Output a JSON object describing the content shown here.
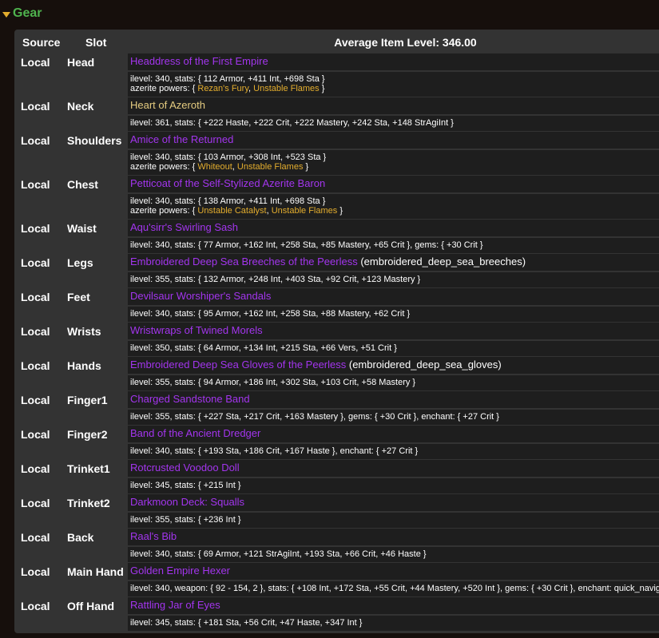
{
  "section": {
    "title": "Gear"
  },
  "table": {
    "headers": {
      "source": "Source",
      "slot": "Slot",
      "summary": "Average Item Level: 346.00"
    },
    "items": [
      {
        "source": "Local",
        "slot": "Head",
        "name": "Headdress of the First Empire",
        "extra": "",
        "detail": "ilevel: 340, stats: { 112 Armor, +411 Int, +698 Sta }",
        "azerite_prefix": "azerite powers: { ",
        "azerite": [
          "Rezan's Fury",
          "Unstable Flames"
        ],
        "azerite_sep": ", ",
        "azerite_suffix": " }"
      },
      {
        "source": "Local",
        "slot": "Neck",
        "name": "Heart of Azeroth",
        "extra": "",
        "detail": "ilevel: 361, stats: { +222 Haste, +222 Crit, +222 Mastery, +242 Sta, +148 StrAgiInt }"
      },
      {
        "source": "Local",
        "slot": "Shoulders",
        "name": "Amice of the Returned",
        "extra": "",
        "detail": "ilevel: 340, stats: { 103 Armor, +308 Int, +523 Sta }",
        "azerite_prefix": "azerite powers: { ",
        "azerite": [
          "Whiteout",
          "Unstable Flames"
        ],
        "azerite_sep": ", ",
        "azerite_suffix": " }"
      },
      {
        "source": "Local",
        "slot": "Chest",
        "name": "Petticoat of the Self-Stylized Azerite Baron",
        "extra": "",
        "detail": "ilevel: 340, stats: { 138 Armor, +411 Int, +698 Sta }",
        "azerite_prefix": "azerite powers: { ",
        "azerite": [
          "Unstable Catalyst",
          "Unstable Flames"
        ],
        "azerite_sep": ", ",
        "azerite_suffix": " }"
      },
      {
        "source": "Local",
        "slot": "Waist",
        "name": "Aqu'sirr's Swirling Sash",
        "extra": "",
        "detail": "ilevel: 340, stats: { 77 Armor, +162 Int, +258 Sta, +85 Mastery, +65 Crit }, gems: { +30 Crit }"
      },
      {
        "source": "Local",
        "slot": "Legs",
        "name": "Embroidered Deep Sea Breeches of the Peerless",
        "extra": " (embroidered_deep_sea_breeches)",
        "detail": "ilevel: 355, stats: { 132 Armor, +248 Int, +403 Sta, +92 Crit, +123 Mastery }"
      },
      {
        "source": "Local",
        "slot": "Feet",
        "name": "Devilsaur Worshiper's Sandals",
        "extra": "",
        "detail": "ilevel: 340, stats: { 95 Armor, +162 Int, +258 Sta, +88 Mastery, +62 Crit }"
      },
      {
        "source": "Local",
        "slot": "Wrists",
        "name": "Wristwraps of Twined Morels",
        "extra": "",
        "detail": "ilevel: 350, stats: { 64 Armor, +134 Int, +215 Sta, +66 Vers, +51 Crit }"
      },
      {
        "source": "Local",
        "slot": "Hands",
        "name": "Embroidered Deep Sea Gloves of the Peerless",
        "extra": " (embroidered_deep_sea_gloves)",
        "detail": "ilevel: 355, stats: { 94 Armor, +186 Int, +302 Sta, +103 Crit, +58 Mastery }"
      },
      {
        "source": "Local",
        "slot": "Finger1",
        "name": "Charged Sandstone Band",
        "extra": "",
        "detail": "ilevel: 355, stats: { +227 Sta, +217 Crit, +163 Mastery }, gems: { +30 Crit }, enchant: { +27 Crit }"
      },
      {
        "source": "Local",
        "slot": "Finger2",
        "name": "Band of the Ancient Dredger",
        "extra": "",
        "detail": "ilevel: 340, stats: { +193 Sta, +186 Crit, +167 Haste }, enchant: { +27 Crit }"
      },
      {
        "source": "Local",
        "slot": "Trinket1",
        "name": "Rotcrusted Voodoo Doll",
        "extra": "",
        "detail": "ilevel: 345, stats: { +215 Int }"
      },
      {
        "source": "Local",
        "slot": "Trinket2",
        "name": "Darkmoon Deck: Squalls",
        "extra": "",
        "detail": "ilevel: 355, stats: { +236 Int }"
      },
      {
        "source": "Local",
        "slot": "Back",
        "name": "Raal's Bib",
        "extra": "",
        "detail": "ilevel: 340, stats: { 69 Armor, +121 StrAgiInt, +193 Sta, +66 Crit, +46 Haste }"
      },
      {
        "source": "Local",
        "slot": "Main Hand",
        "name": "Golden Empire Hexer",
        "extra": "",
        "detail": "ilevel: 340, weapon: { 92 - 154, 2 }, stats: { +108 Int, +172 Sta, +55 Crit, +44 Mastery, +520 Int }, gems: { +30 Crit }, enchant: quick_navig"
      },
      {
        "source": "Local",
        "slot": "Off Hand",
        "name": "Rattling Jar of Eyes",
        "extra": "",
        "detail": "ilevel: 345, stats: { +181 Sta, +56 Crit, +47 Haste, +347 Int }"
      }
    ]
  },
  "colors": {
    "epic": "#a335ee",
    "artifact": "#e5cc80",
    "azerite": "#e3ad2e",
    "section": "#4fb34e"
  }
}
